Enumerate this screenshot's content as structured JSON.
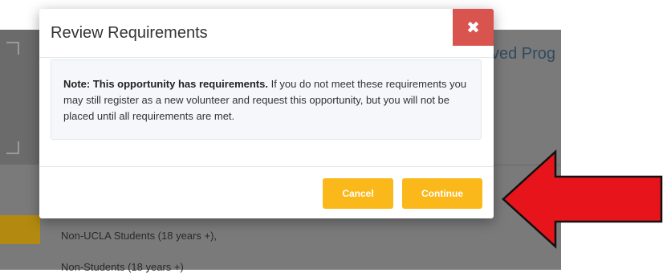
{
  "background": {
    "heading_partial": "ved Prog",
    "list_items": [
      "Non-UCLA Students (18 years +),",
      "Non-Students (18 years +)"
    ]
  },
  "modal": {
    "title": "Review Requirements",
    "close_glyph": "✖",
    "note_bold": "Note: This opportunity has requirements.",
    "note_text": " If you do not meet these requirements you may still register as a new volunteer and request this opportunity, but you will not be placed until all requirements are met.",
    "cancel_label": "Cancel",
    "continue_label": "Continue"
  },
  "colors": {
    "accent_button": "#fbb81a",
    "close_button": "#d9534f",
    "annotation_arrow": "#e8141b"
  },
  "annotation": {
    "arrow_icon": "red-arrow-pointing-left"
  }
}
